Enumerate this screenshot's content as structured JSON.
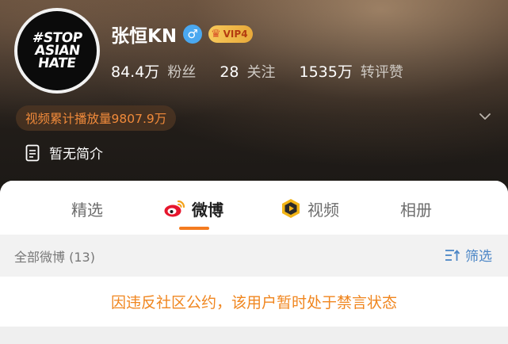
{
  "profile": {
    "avatar_lines": [
      "#STOP",
      "ASIAN",
      "HATE"
    ],
    "name": "张恒KN",
    "gender_symbol": "♂",
    "vip_label": "VIP4",
    "stats": [
      {
        "value": "84.4万",
        "label": "粉丝"
      },
      {
        "value": "28",
        "label": "关注"
      },
      {
        "value": "1535万",
        "label": "转评赞"
      }
    ],
    "plays": "视频累计播放量9807.9万",
    "intro": "暂无简介"
  },
  "tabs": [
    {
      "label": "精选",
      "active": false
    },
    {
      "label": "微博",
      "active": true
    },
    {
      "label": "视频",
      "active": false
    },
    {
      "label": "相册",
      "active": false
    }
  ],
  "filter": {
    "left": "全部微博 (13)",
    "right": "筛选"
  },
  "notice": "因违反社区公约，该用户暂时处于禁言状态",
  "colors": {
    "accent": "#f47b1f",
    "notice": "#f0861f",
    "link": "#4c86c6",
    "gender": "#4aa8f0"
  }
}
